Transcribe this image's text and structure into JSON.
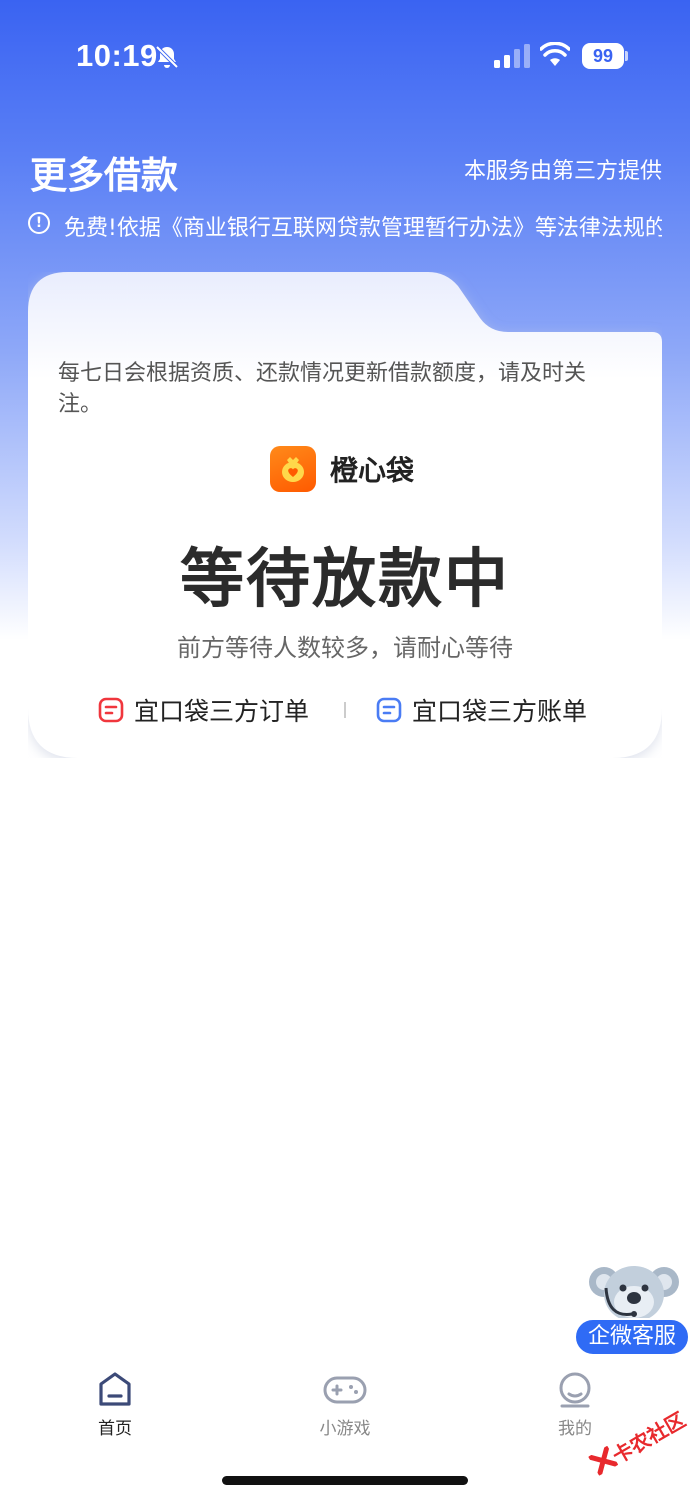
{
  "status_bar": {
    "time": "10:19",
    "battery": "99"
  },
  "header": {
    "title": "更多借款",
    "provider_note": "本服务由第三方提供",
    "notice": "免费!依据《商业银行互联网贷款管理暂行办法》等法律法规的规定"
  },
  "card": {
    "description": "每七日会根据资质、还款情况更新借款额度，请及时关注。",
    "brand_name": "橙心袋",
    "status_title": "等待放款中",
    "status_subtitle": "前方等待人数较多，请耐心等待",
    "link_orders": "宜口袋三方订单",
    "link_bills": "宜口袋三方账单"
  },
  "service": {
    "label": "企微客服"
  },
  "tabbar": {
    "items": [
      {
        "label": "首页",
        "active": true
      },
      {
        "label": "小游戏",
        "active": false
      },
      {
        "label": "我的",
        "active": false
      }
    ]
  },
  "watermark": {
    "text": "卡农社区"
  },
  "colors": {
    "primary": "#3a63f2",
    "brand_orange": "#ff6a00",
    "order_icon_red": "#f0363d",
    "bill_icon_blue": "#4a7cf4"
  }
}
